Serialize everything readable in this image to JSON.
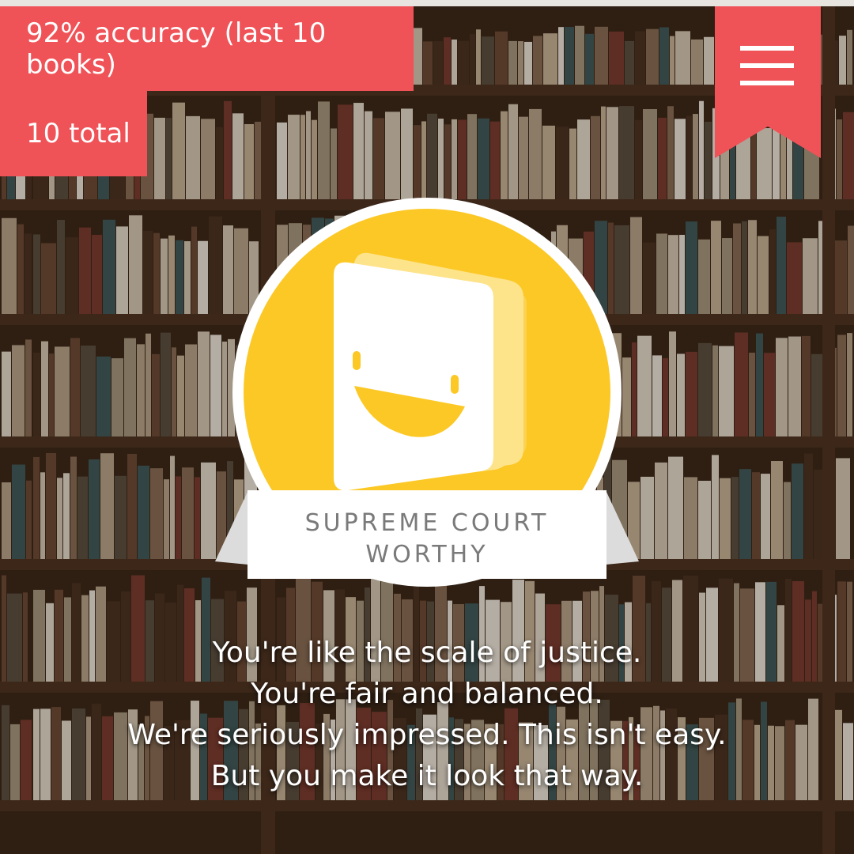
{
  "stats": {
    "accuracy": "92% accuracy (last 10 books)",
    "total": "10 total"
  },
  "badge": {
    "title_line1": "SUPREME COURT",
    "title_line2": "WORTHY",
    "icon": "smiling-book-icon"
  },
  "message": {
    "lines": [
      "You're like the scale of justice.",
      "You're fair and balanced.",
      "We're seriously impressed. This isn't easy.",
      "But you make it look that way."
    ]
  },
  "menu": {
    "icon": "hamburger-menu-icon"
  },
  "colors": {
    "accent": "#ef5257",
    "badge_yellow": "#fcc825",
    "badge_ribbon": "#ffffff",
    "badge_text": "#7a7a7a",
    "text": "#ffffff"
  }
}
